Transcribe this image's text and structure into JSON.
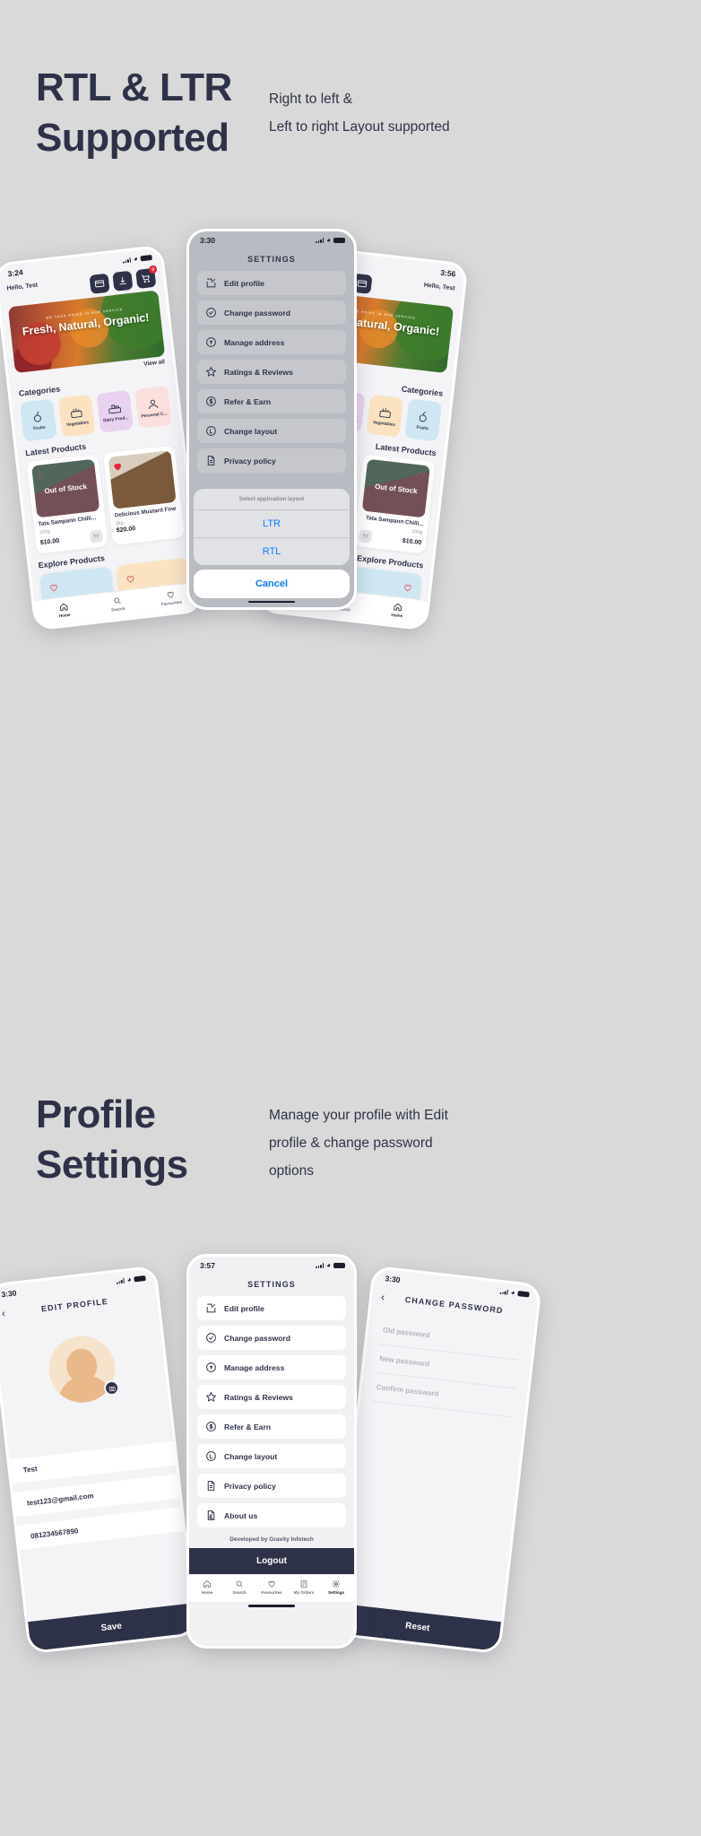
{
  "sections": [
    {
      "title": "RTL & LTR\nSupported",
      "copy": "Right to left &\nLeft to right Layout supported"
    },
    {
      "title": "Profile\nSettings",
      "copy": "Manage your profile with Edit\nprofile & change password\noptions"
    }
  ],
  "settings_menu": [
    {
      "label": "Edit profile",
      "icon": "edit-square-icon"
    },
    {
      "label": "Change password",
      "icon": "check-badge-icon"
    },
    {
      "label": "Manage address",
      "icon": "location-pin-icon"
    },
    {
      "label": "Ratings & Reviews",
      "icon": "star-icon"
    },
    {
      "label": "Refer & Earn",
      "icon": "dollar-coin-icon"
    },
    {
      "label": "Change layout",
      "icon": "layout-circle-icon"
    },
    {
      "label": "Privacy policy",
      "icon": "document-icon"
    },
    {
      "label": "About us",
      "icon": "document-search-icon"
    }
  ],
  "settings_screen": {
    "title": "SETTINGS",
    "time_gray": "3:30",
    "time_light": "3:57",
    "developed_by": "Developed by Gravity Infotech",
    "logout_label": "Logout"
  },
  "action_sheet": {
    "header": "Select application layout",
    "options": [
      "LTR",
      "RTL"
    ],
    "cancel": "Cancel"
  },
  "home_screen": {
    "time_left": "3:24",
    "time_right": "3:56",
    "greeting": "Hello,\nTest",
    "cart_badge": "0",
    "banner": {
      "kicker": "WE TAKE PRIDE IN OUR SERVICE",
      "headline": "Fresh, Natural,\nOrganic!"
    },
    "view_all": "View all",
    "categories_label": "Categories",
    "categories": [
      {
        "name": "Fruits",
        "color": "#cfe7f3"
      },
      {
        "name": "Vegetables",
        "color": "#fbe3c2"
      },
      {
        "name": "Dairy Prod...",
        "color": "#e9d2f0"
      },
      {
        "name": "Personal C...",
        "color": "#fadfdc"
      }
    ],
    "latest_label": "Latest Products",
    "explore_label": "Explore Products",
    "products": [
      {
        "name": "Tata Sampann Chilli...",
        "qty": "100g",
        "price": "$10.00",
        "status": "Out of Stock"
      },
      {
        "name": "Delicious Mustard Fine",
        "qty": "2kg",
        "price": "$20.00",
        "status": ""
      }
    ],
    "tabs": [
      {
        "label": "Home",
        "icon": "home-icon"
      },
      {
        "label": "Search",
        "icon": "search-icon"
      },
      {
        "label": "Favourites",
        "icon": "heart-icon"
      }
    ]
  },
  "settings_tabs": [
    {
      "label": "Home",
      "icon": "home-icon"
    },
    {
      "label": "Search",
      "icon": "search-icon"
    },
    {
      "label": "Favourites",
      "icon": "heart-icon"
    },
    {
      "label": "My Orders",
      "icon": "orders-icon"
    },
    {
      "label": "Settings",
      "icon": "settings-icon"
    }
  ],
  "edit_profile": {
    "time": "3:30",
    "title": "EDIT PROFILE",
    "name": "Test",
    "email": "test123@gmail.com",
    "phone": "081234567890",
    "save_label": "Save"
  },
  "change_password": {
    "time": "3:30",
    "title": "CHANGE PASSWORD",
    "old_placeholder": "Old password",
    "new_placeholder": "New password",
    "confirm_placeholder": "Confirm password",
    "reset_label": "Reset"
  },
  "colors": {
    "bg": "#d9d9d9",
    "ink": "#2e3248",
    "accent_blue": "#0a7aff",
    "badge_red": "#e8243c"
  }
}
